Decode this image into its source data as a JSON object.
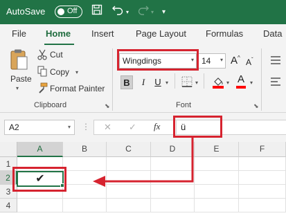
{
  "titlebar": {
    "autosave_label": "AutoSave",
    "autosave_state": "Off",
    "save_icon": "save-icon",
    "undo_icon": "undo-icon",
    "redo_icon": "redo-icon",
    "more_icon": "customize-qat-icon",
    "background": "#217346"
  },
  "tabs": [
    "File",
    "Home",
    "Insert",
    "Page Layout",
    "Formulas",
    "Data"
  ],
  "active_tab": "Home",
  "clipboard": {
    "paste_label": "Paste",
    "cut_label": "Cut",
    "copy_label": "Copy",
    "format_painter_label": "Format Painter",
    "group_label": "Clipboard"
  },
  "font": {
    "font_name": "Wingdings",
    "font_size": "14",
    "grow_label": "A",
    "shrink_label": "A",
    "bold": "B",
    "italic": "I",
    "underline": "U",
    "font_color_label": "A",
    "group_label": "Font",
    "fill_color": "#ff0000",
    "font_color": "#ff0000"
  },
  "formula_bar": {
    "name_box": "A2",
    "cancel": "✕",
    "enter": "✓",
    "fx": "fx",
    "value": "ü"
  },
  "grid": {
    "columns": [
      "A",
      "B",
      "C",
      "D",
      "E",
      "F"
    ],
    "rows": [
      "1",
      "2",
      "3",
      "4"
    ],
    "active_cell": "A2",
    "a2_display": "✔"
  },
  "highlight_color": "#d6232f",
  "accent_color": "#217346"
}
